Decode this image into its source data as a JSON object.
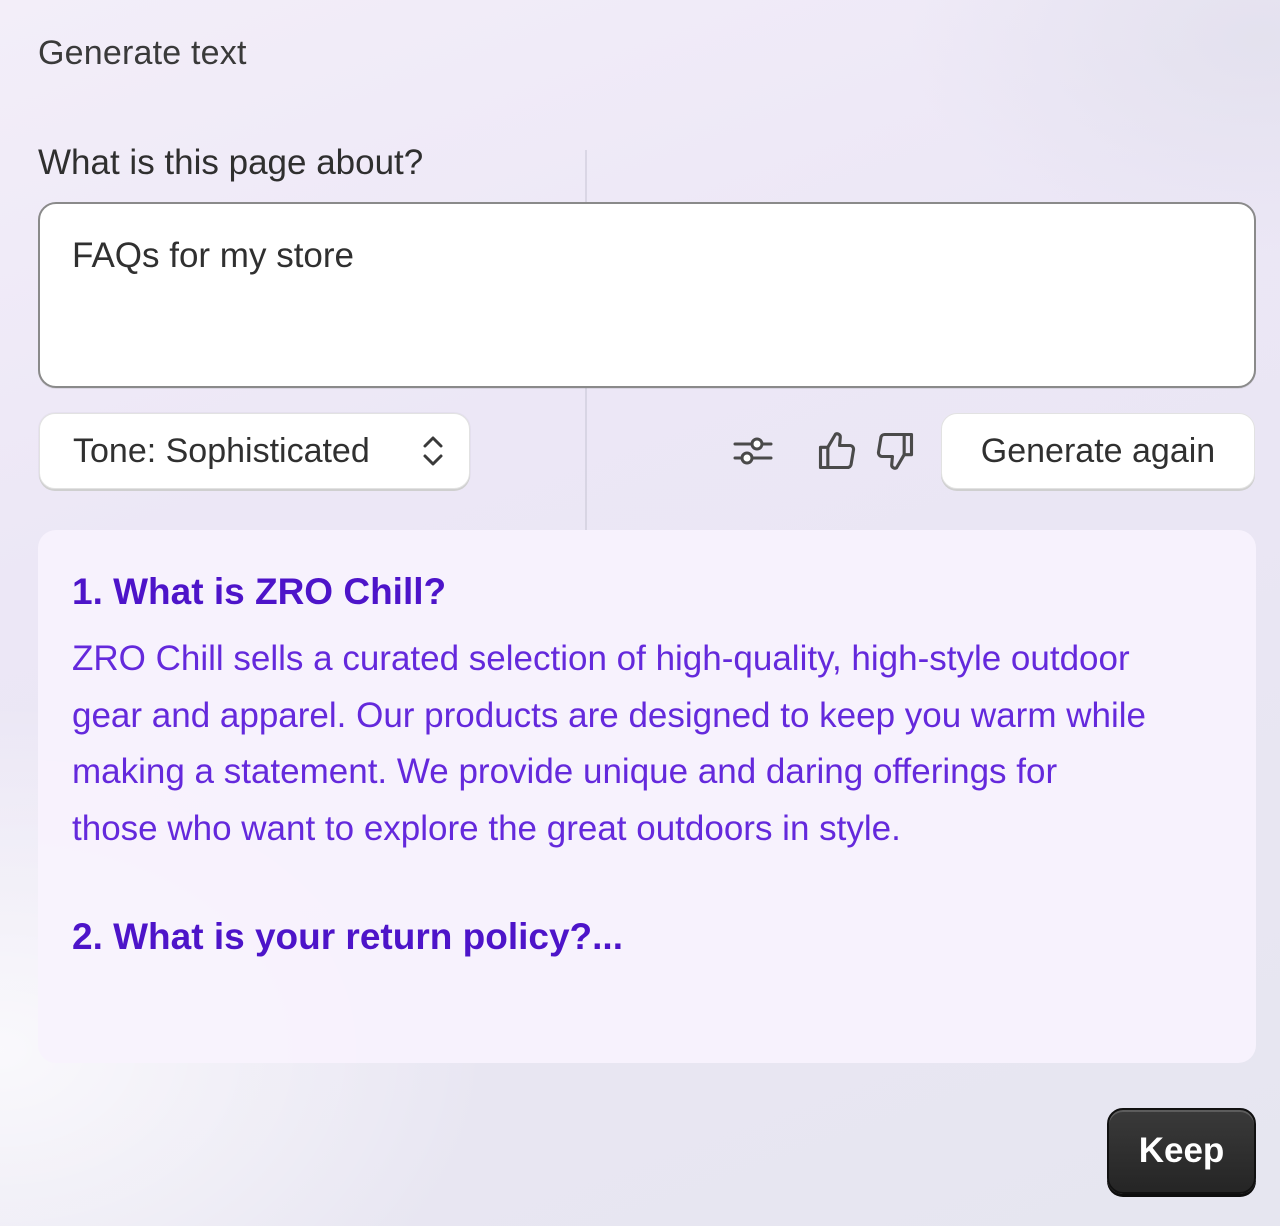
{
  "panel": {
    "title": "Generate text"
  },
  "prompt": {
    "label": "What is this page about?",
    "value": "FAQs for my store"
  },
  "controls": {
    "tone_label": "Tone: Sophisticated",
    "tone_icon": "chevron-up-down-icon",
    "settings_icon": "sliders-icon",
    "thumbs_up_icon": "thumbs-up-icon",
    "thumbs_down_icon": "thumbs-down-icon",
    "generate_again_label": "Generate again"
  },
  "result": {
    "items": [
      {
        "question": "1. What is ZRO Chill?",
        "answer": "ZRO Chill sells a curated selection of high-quality, high-style outdoor gear and apparel. Our products are designed to keep you warm while making a statement. We provide unique and daring offerings for those who want to explore the great outdoors in style."
      },
      {
        "question": "2. What is your return policy?..."
      }
    ]
  },
  "footer": {
    "keep_label": "Keep"
  },
  "colors": {
    "accent_text": "#5b1fd6",
    "primary_button": "#2b2b2b"
  }
}
